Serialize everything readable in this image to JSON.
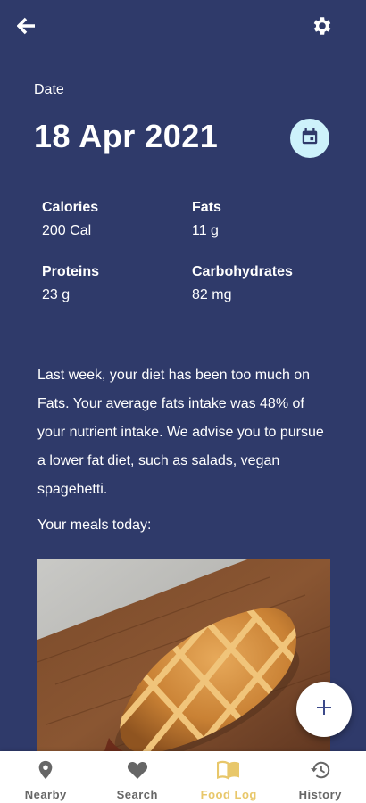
{
  "header": {
    "back_icon": "arrow-left-icon",
    "settings_icon": "gear-icon"
  },
  "date": {
    "label": "Date",
    "value": "18 Apr 2021",
    "calendar_icon": "calendar-icon"
  },
  "nutrients": [
    {
      "name": "Calories",
      "value": "200 Cal"
    },
    {
      "name": "Fats",
      "value": "11 g"
    },
    {
      "name": "Proteins",
      "value": "23 g"
    },
    {
      "name": "Carbohydrates",
      "value": "82 mg"
    }
  ],
  "advice": "Last week, your diet has been too much on Fats. Your average fats intake was 48% of your nutrient intake. We advise you to pursue a lower fat diet, such as salads, vegan spagehetti.",
  "meals_label": "Your meals today:",
  "fab": {
    "icon": "plus-icon"
  },
  "nav": [
    {
      "label": "Nearby",
      "icon": "map-pin-icon",
      "active": false
    },
    {
      "label": "Search",
      "icon": "heart-icon",
      "active": false
    },
    {
      "label": "Food Log",
      "icon": "book-icon",
      "active": true
    },
    {
      "label": "History",
      "icon": "history-icon",
      "active": false
    }
  ],
  "colors": {
    "background": "#2f3a6a",
    "accent": "#e8c76a",
    "inactive": "#666666",
    "fab_icon": "#3c4a8a",
    "calendar_bg": "#cdf2fb"
  }
}
